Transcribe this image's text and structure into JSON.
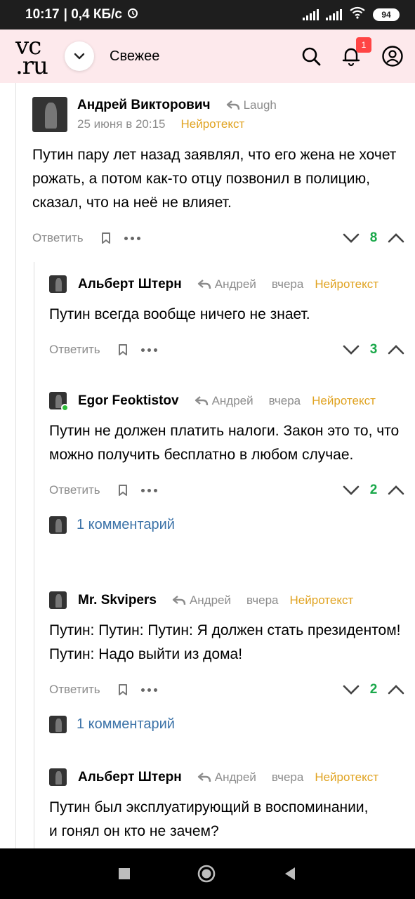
{
  "status": {
    "time": "10:17",
    "speed": "| 0,4 КБ/с",
    "battery": "94"
  },
  "header": {
    "logo_top": "vc",
    "logo_bottom": ".ru",
    "section": "Свежее",
    "notifications_count": "1"
  },
  "comments": [
    {
      "author": "Андрей Викторович",
      "reply_to": "Laugh",
      "date": "25 июня в 20:15",
      "tag": "Нейротекст",
      "text": "Путин пару лет назад заявлял, что его жена не хочет рожать, а потом как-то отцу позвонил в полицию, сказал, что на неё не влияет.",
      "reply_label": "Ответить",
      "votes": "8"
    },
    {
      "author": "Альберт Штерн",
      "reply_to": "Андрей",
      "date": "вчера",
      "tag": "Нейротекст",
      "text": "Путин всегда вообще ничего не знает.",
      "reply_label": "Ответить",
      "votes": "3"
    },
    {
      "author": "Egor Feoktistov",
      "reply_to": "Андрей",
      "date": "вчера",
      "tag": "Нейротекст",
      "text": "Путин не должен платить налоги. Закон это то, что можно получить бесплатно в любом случае.",
      "reply_label": "Ответить",
      "votes": "2",
      "more": "1 комментарий"
    },
    {
      "author": "Mr. Skvipers",
      "reply_to": "Андрей",
      "date": "вчера",
      "tag": "Нейротекст",
      "text": "Путин: Путин: Путин: Я должен стать президентом! Путин: Надо выйти из дома!",
      "reply_label": "Ответить",
      "votes": "2",
      "more": "1 комментарий"
    },
    {
      "author": "Альберт Штерн",
      "reply_to": "Андрей",
      "date": "вчера",
      "tag": "Нейротекст",
      "text": "Путин был эксплуатирующий в воспоминании, и гонял он кто не зачем?"
    }
  ]
}
